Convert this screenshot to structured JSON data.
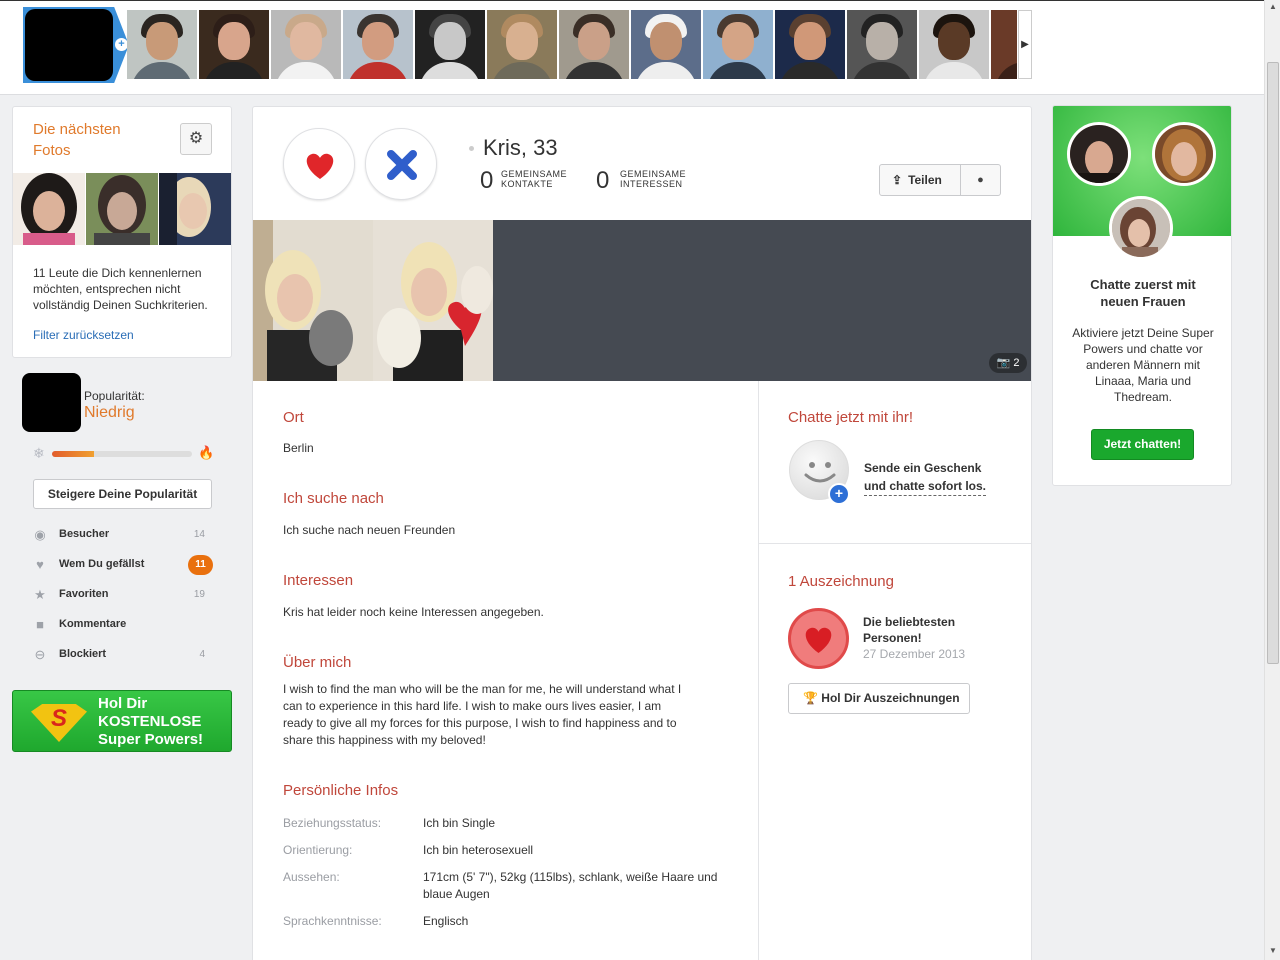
{
  "sidebar": {
    "next_photos_title": "Die nächsten Fotos",
    "next_photos_text": "11 Leute die Dich kennenlernen möchten, entsprechen nicht vollständig Deinen Suchkriterien.",
    "reset_filter": "Filter zurücksetzen",
    "popularity_label": "Popularität:",
    "popularity_value": "Niedrig",
    "popularity_level": 0.3,
    "boost_button": "Steigere Deine Popularität",
    "nav": [
      {
        "label": "Besucher",
        "count": "14",
        "icon": "eye-icon"
      },
      {
        "label": "Wem Du gefällst",
        "count": "11",
        "icon": "heart-icon"
      },
      {
        "label": "Favoriten",
        "count": "19",
        "icon": "star-icon"
      },
      {
        "label": "Kommentare",
        "count": "",
        "icon": "speech-bubble-icon"
      },
      {
        "label": "Blockiert",
        "count": "4",
        "icon": "block-icon"
      }
    ],
    "superpowers_line1": "Hol Dir",
    "superpowers_line2": "KOSTENLOSE",
    "superpowers_line3": "Super Powers!"
  },
  "profile": {
    "name": "Kris, 33",
    "common_contacts_count": "0",
    "common_contacts_label1": "GEMEINSAME",
    "common_contacts_label2": "KONTAKTE",
    "common_interests_count": "0",
    "common_interests_label1": "GEMEINSAME",
    "common_interests_label2": "INTERESSEN",
    "share_button": "Teilen",
    "photo_count": "2",
    "sections": {
      "location_title": "Ort",
      "location_value": "Berlin",
      "looking_title": "Ich suche nach",
      "looking_value": "Ich suche nach neuen Freunden",
      "interests_title": "Interessen",
      "interests_value": "Kris hat leider noch keine Interessen angegeben.",
      "about_title": "Über mich",
      "about_line1": "I wish to find the man who will be the man for me, he will understand what I",
      "about_line2": "can to experience in this hard life. I wish to make ours lives easier, I am",
      "about_line3": "ready to give all my forces for this purpose, I wish to find happiness and to",
      "about_line4": "share this happiness with my beloved!",
      "personal_title": "Persönliche Infos"
    },
    "personal_info": [
      {
        "label": "Beziehungsstatus:",
        "value": "Ich bin Single"
      },
      {
        "label": "Orientierung:",
        "value": "Ich bin heterosexuell"
      },
      {
        "label": "Aussehen:",
        "value": "171cm (5' 7\"), 52kg (115lbs), schlank, weiße Haare und blaue Augen"
      },
      {
        "label": "Sprachkenntnisse:",
        "value": "Englisch"
      }
    ]
  },
  "chat": {
    "title": "Chatte jetzt mit ihr!",
    "gift_line1": "Sende ein Geschenk",
    "gift_line2": "und chatte sofort los."
  },
  "awards": {
    "title": "1 Auszeichnung",
    "name_line1": "Die beliebtesten",
    "name_line2": "Personen!",
    "date": "27 Dezember 2013",
    "button": "Hol Dir Auszeichnungen"
  },
  "promo": {
    "heading_line1": "Chatte zuerst mit",
    "heading_line2": "neuen Frauen",
    "text": "Aktiviere jetzt Deine Super Powers und chatte vor anderen Männern mit Linaaa, Maria und Thedream.",
    "button": "Jetzt chatten!"
  },
  "colors": {
    "accent_orange": "#e07a2c",
    "section_red": "#c0473b",
    "link_blue": "#2a6db6",
    "green": "#1aa82d",
    "badge_orange": "#e9700e"
  }
}
